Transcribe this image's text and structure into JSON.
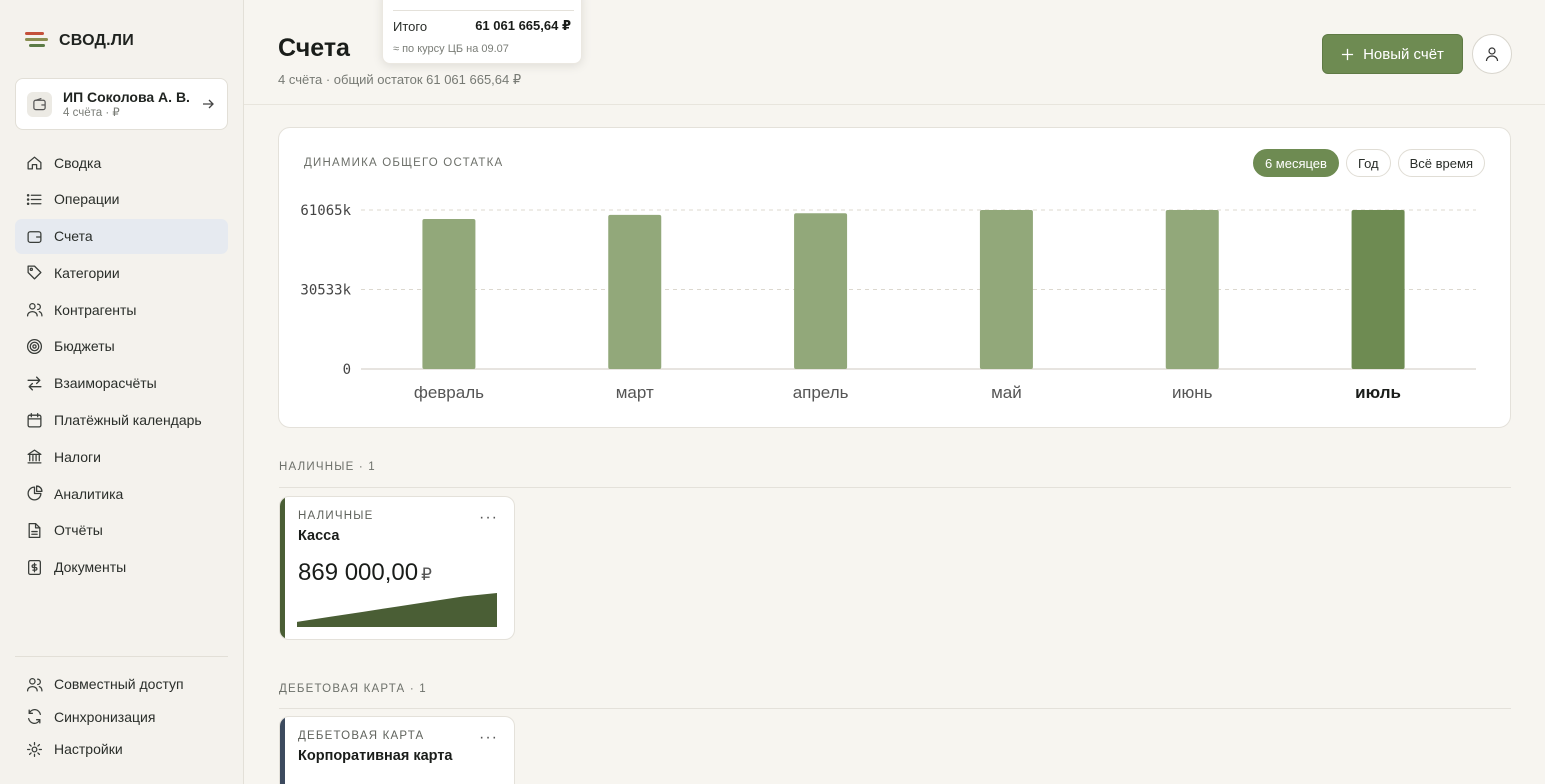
{
  "app": {
    "name": "СВОД.ЛИ",
    "colors": {
      "accent": "#6e8b52",
      "bar": "#92a87a",
      "bar_active": "#6e8b52",
      "logo_red": "#c4503a",
      "logo_olive": "#8a8f52",
      "logo_green": "#5b7b46",
      "cash_stripe": "#4a5e35",
      "debit_stripe": "#3c4a5e"
    }
  },
  "org": {
    "name": "ИП Соколова А. В.",
    "sub": "4 счёта · ₽",
    "icon": "wallet-icon",
    "action_icon": "arrow-right-icon"
  },
  "nav": [
    {
      "label": "Сводка",
      "icon": "home-icon"
    },
    {
      "label": "Операции",
      "icon": "list-icon"
    },
    {
      "label": "Счета",
      "icon": "wallet-icon",
      "active": true
    },
    {
      "label": "Категории",
      "icon": "tag-icon"
    },
    {
      "label": "Контрагенты",
      "icon": "users-icon"
    },
    {
      "label": "Бюджеты",
      "icon": "target-icon"
    },
    {
      "label": "Взаиморасчёты",
      "icon": "swap-icon"
    },
    {
      "label": "Платёжный календарь",
      "icon": "calendar-icon"
    },
    {
      "label": "Налоги",
      "icon": "bank-icon"
    },
    {
      "label": "Аналитика",
      "icon": "pie-icon"
    },
    {
      "label": "Отчёты",
      "icon": "file-icon"
    },
    {
      "label": "Документы",
      "icon": "dollar-doc-icon"
    }
  ],
  "nav_bottom": [
    {
      "label": "Совместный доступ",
      "icon": "share-users-icon"
    },
    {
      "label": "Синхронизация",
      "icon": "sync-icon"
    },
    {
      "label": "Настройки",
      "icon": "gear-icon"
    }
  ],
  "header": {
    "title": "Счета",
    "subtitle": "4 счёта · общий остаток 61 061 665,64 ₽",
    "new_button": "Новый счёт",
    "new_icon": "plus-icon",
    "user_icon": "user-icon"
  },
  "tooltip": {
    "label": "Итого",
    "value": "61 061 665,64 ₽",
    "note": "≈ по курсу ЦБ на 09.07"
  },
  "chart_section": {
    "title": "ДИНАМИКА ОБЩЕГО ОСТАТКА",
    "periods": [
      {
        "label": "6 месяцев",
        "active": true
      },
      {
        "label": "Год",
        "active": false
      },
      {
        "label": "Всё время",
        "active": false
      }
    ]
  },
  "chart_data": {
    "type": "bar",
    "categories": [
      "февраль",
      "март",
      "апрель",
      "май",
      "июнь",
      "июль"
    ],
    "values": [
      57600,
      59200,
      59800,
      61100,
      61900,
      62600
    ],
    "y_ticks": [
      {
        "value": 0,
        "label": "0"
      },
      {
        "value": 30533,
        "label": "30533k"
      },
      {
        "value": 61065,
        "label": "61065k"
      }
    ],
    "ylim": [
      0,
      61065
    ],
    "highlighted": "июль",
    "grid": true
  },
  "sections": [
    {
      "label": "НАЛИЧНЫЕ · 1",
      "account": {
        "type": "НАЛИЧНЫЕ",
        "name": "Касса",
        "balance": "869 000,00",
        "currency": "₽",
        "menu": "···",
        "trend": [
          0.15,
          0.3,
          0.45,
          0.6,
          0.75,
          0.9,
          1.0
        ]
      }
    },
    {
      "label": "ДЕБЕТОВАЯ КАРТА · 1",
      "account": {
        "type": "ДЕБЕТОВАЯ КАРТА",
        "name": "Корпоративная карта",
        "menu": "···"
      }
    }
  ]
}
